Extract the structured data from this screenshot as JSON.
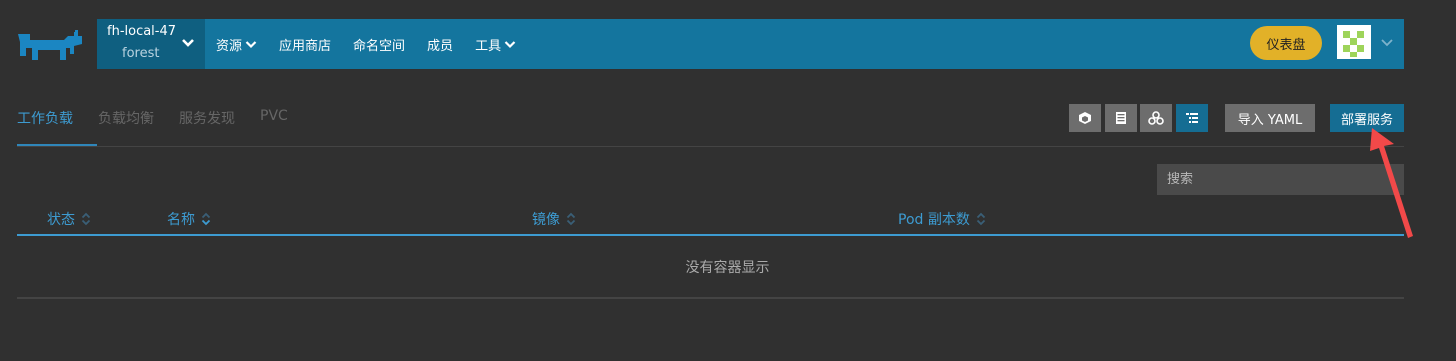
{
  "colors": {
    "background": "#303030",
    "topbar": "#14759e",
    "cluster_panel": "#0f5f80",
    "accent": "#3d9bd1",
    "dashboard_button": "#e2b128",
    "primary_button": "#156d93",
    "secondary_button": "#6d6d6d",
    "annotation_arrow": "#f24949"
  },
  "header": {
    "logo_icon": "cattle-logo-icon",
    "cluster": {
      "name": "fh-local-47",
      "project": "forest"
    },
    "nav": [
      {
        "label": "资源",
        "dropdown": true
      },
      {
        "label": "应用商店",
        "dropdown": false
      },
      {
        "label": "命名空间",
        "dropdown": false
      },
      {
        "label": "成员",
        "dropdown": false
      },
      {
        "label": "工具",
        "dropdown": true
      }
    ],
    "dashboard_label": "仪表盘",
    "avatar_icon": "identicon-avatar"
  },
  "tabs": [
    {
      "label": "工作负载",
      "active": true
    },
    {
      "label": "负载均衡",
      "active": false
    },
    {
      "label": "服务发现",
      "active": false
    },
    {
      "label": "PVC",
      "active": false
    }
  ],
  "toolbar": {
    "view_icons": [
      "cube-icon",
      "list-icon",
      "cluster-icon",
      "tree-list-icon"
    ],
    "active_view": "tree-list-icon",
    "import_label": "导入 YAML",
    "deploy_label": "部署服务"
  },
  "search": {
    "placeholder": "搜索",
    "value": ""
  },
  "table": {
    "columns": [
      "状态",
      "名称",
      "镜像",
      "Pod 副本数"
    ],
    "sorted_column": "名称",
    "empty_message": "没有容器显示"
  }
}
